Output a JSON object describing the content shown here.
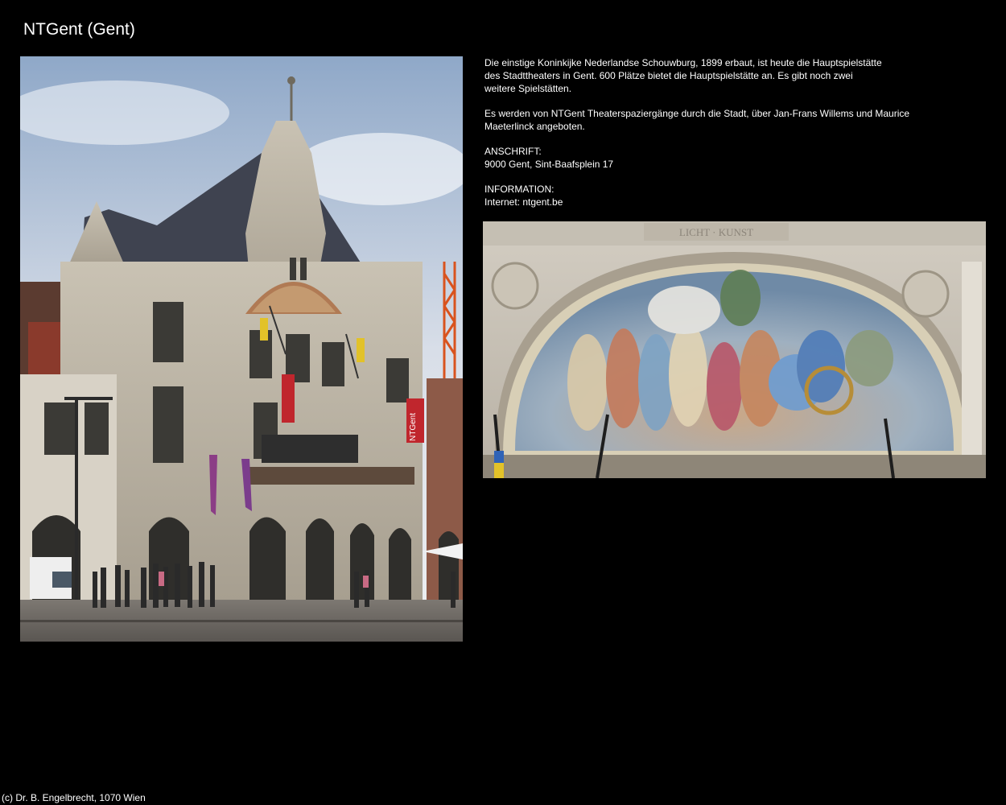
{
  "page": {
    "title": "NTGent (Gent)",
    "footer": "(c) Dr. B. Engelbrecht, 1070 Wien"
  },
  "description": {
    "paragraph1": [
      "Die einstige Koninkijke Nederlandse Schouwburg, 1899 erbaut, ist heute die Hauptspielstätte",
      "des Stadttheaters in Gent. 600 Plätze bietet die Hauptspielstätte an. Es gibt noch zwei",
      "weitere Spielstätten."
    ],
    "paragraph2": [
      "Es werden von NTGent Theaterspaziergänge durch die Stadt, über Jan-Frans Willems und Maurice",
      "Maeterlinck angeboten."
    ],
    "address_heading": "ANSCHRIFT:",
    "address": "9000 Gent, Sint-Baafsplein 17",
    "info_heading": "INFORMATION:",
    "info": "Internet: ntgent.be"
  },
  "images": {
    "building_banner_text": "NTGent",
    "mosaic_inscription": "LICHT · KUNST"
  },
  "colors": {
    "background": "#000000",
    "text": "#ffffff",
    "sky": "#dfe4ea",
    "stone": "#b9b1a2",
    "roof": "#3f4350",
    "banner": "#c0262d"
  }
}
